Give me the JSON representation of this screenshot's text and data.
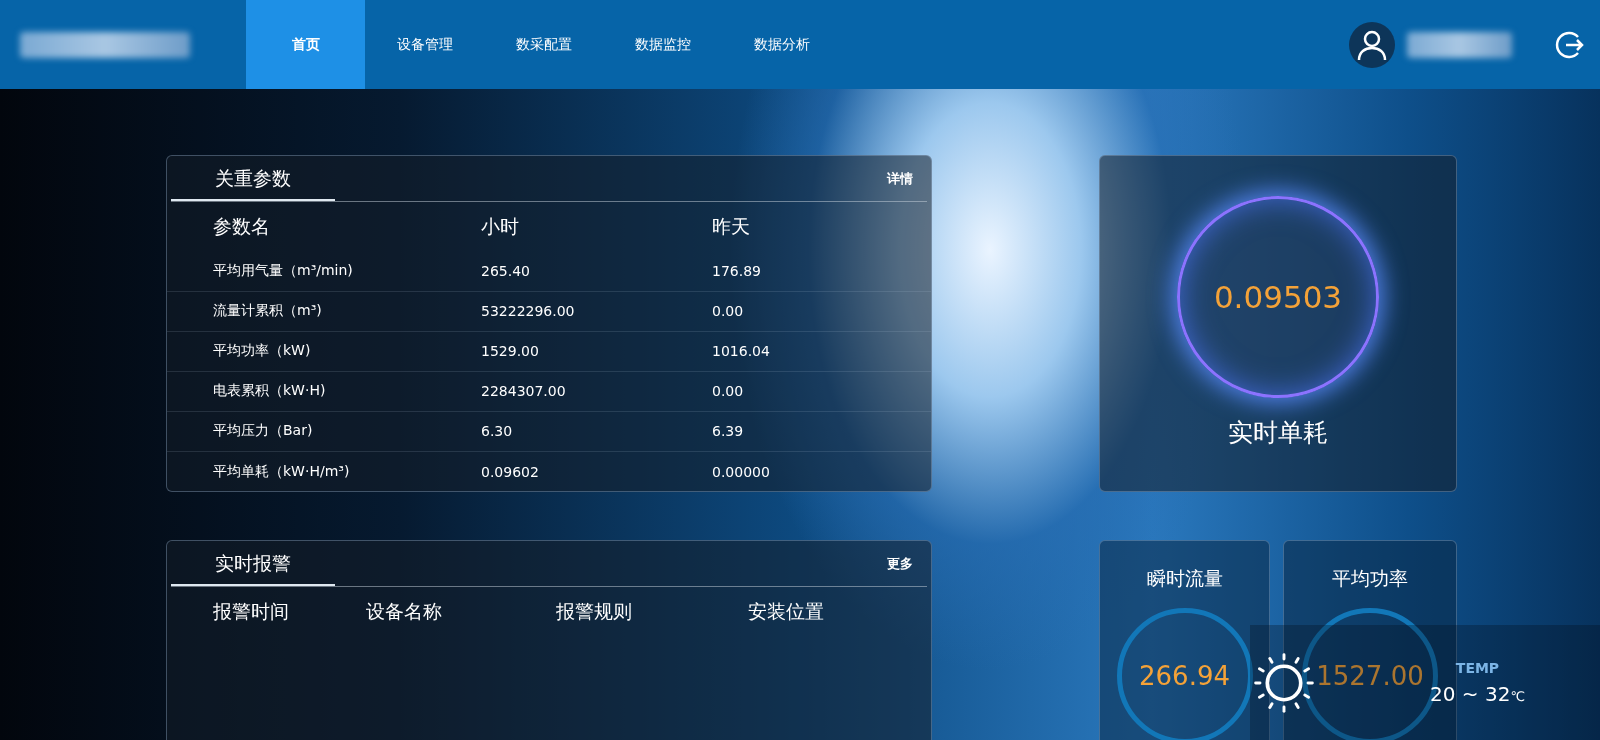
{
  "nav": {
    "tabs": [
      {
        "label": "首页",
        "selected": true
      },
      {
        "label": "设备管理",
        "selected": false
      },
      {
        "label": "数采配置",
        "selected": false
      },
      {
        "label": "数据监控",
        "selected": false
      },
      {
        "label": "数据分析",
        "selected": false
      }
    ]
  },
  "params_panel": {
    "title": "关重参数",
    "link": "详情",
    "columns": [
      "参数名",
      "小时",
      "昨天"
    ],
    "rows": [
      {
        "name": "平均用气量（m³/min)",
        "hour": "265.40",
        "yesterday": "176.89"
      },
      {
        "name": "流量计累积（m³)",
        "hour": "53222296.00",
        "yesterday": "0.00"
      },
      {
        "name": "平均功率（kW)",
        "hour": "1529.00",
        "yesterday": "1016.04"
      },
      {
        "name": "电表累积（kW·H)",
        "hour": "2284307.00",
        "yesterday": "0.00"
      },
      {
        "name": "平均压力（Bar)",
        "hour": "6.30",
        "yesterday": "6.39"
      },
      {
        "name": "平均单耗（kW·H/m³)",
        "hour": "0.09602",
        "yesterday": "0.00000"
      }
    ]
  },
  "alarm_panel": {
    "title": "实时报警",
    "link": "更多",
    "columns": [
      "报警时间",
      "设备名称",
      "报警规则",
      "安装位置"
    ]
  },
  "realtime_panel": {
    "value": "0.09503",
    "label": "实时单耗"
  },
  "small_cards": [
    {
      "label": "瞬时流量",
      "value": "266.94"
    },
    {
      "label": "平均功率",
      "value": "1527.00"
    }
  ],
  "weather": {
    "label": "TEMP",
    "range": "20 ~ 32",
    "unit": "℃"
  }
}
